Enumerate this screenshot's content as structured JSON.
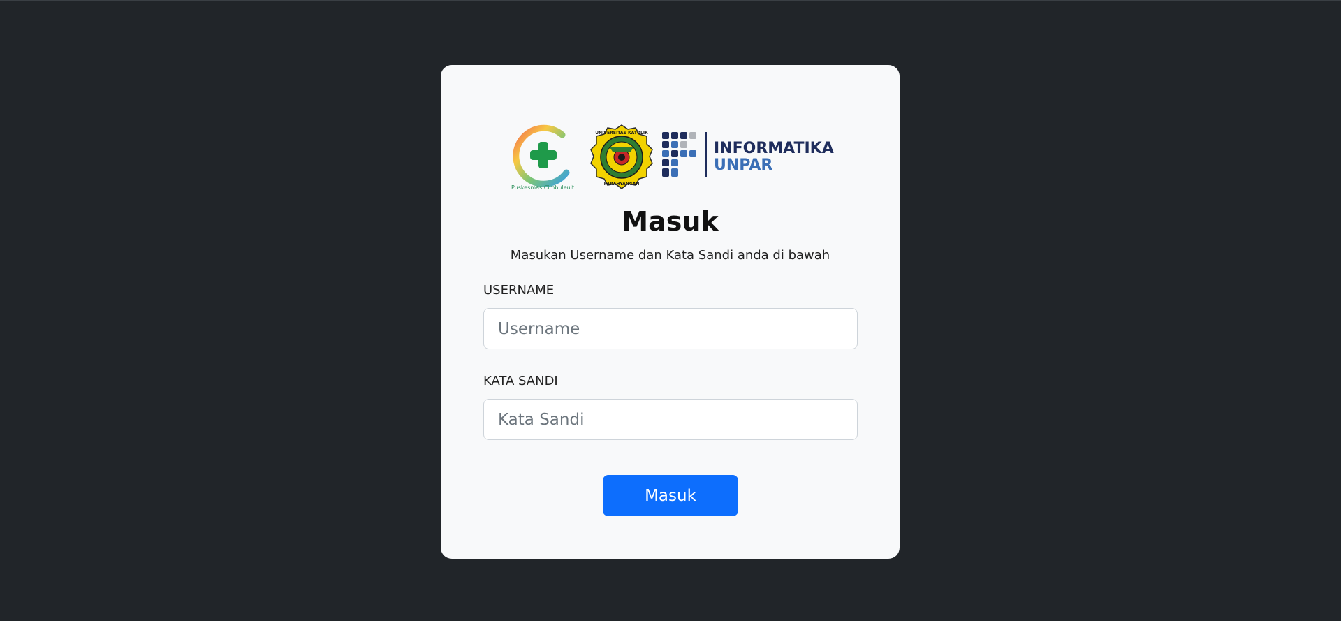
{
  "colors": {
    "background": "#212529",
    "card": "#f8f9fa",
    "primary_button": "#0d6efd",
    "informatika_navy": "#1f2d5c",
    "unpar_blue": "#3b6fb6"
  },
  "logos": {
    "puskesmas_text": "Puskesmas Cimbuleuit",
    "unpar_top_text": "UNIVERSITAS KATOLIK",
    "unpar_bottom_text": "PARAHYANGAN",
    "informatika_line1": "INFORMATIKA",
    "informatika_line2": "UNPAR"
  },
  "login": {
    "title": "Masuk",
    "subtitle": "Masukan Username dan Kata Sandi anda di bawah",
    "username_label": "USERNAME",
    "username_placeholder": "Username",
    "username_value": "",
    "password_label": "KATA SANDI",
    "password_placeholder": "Kata Sandi",
    "password_value": "",
    "submit_label": "Masuk"
  }
}
